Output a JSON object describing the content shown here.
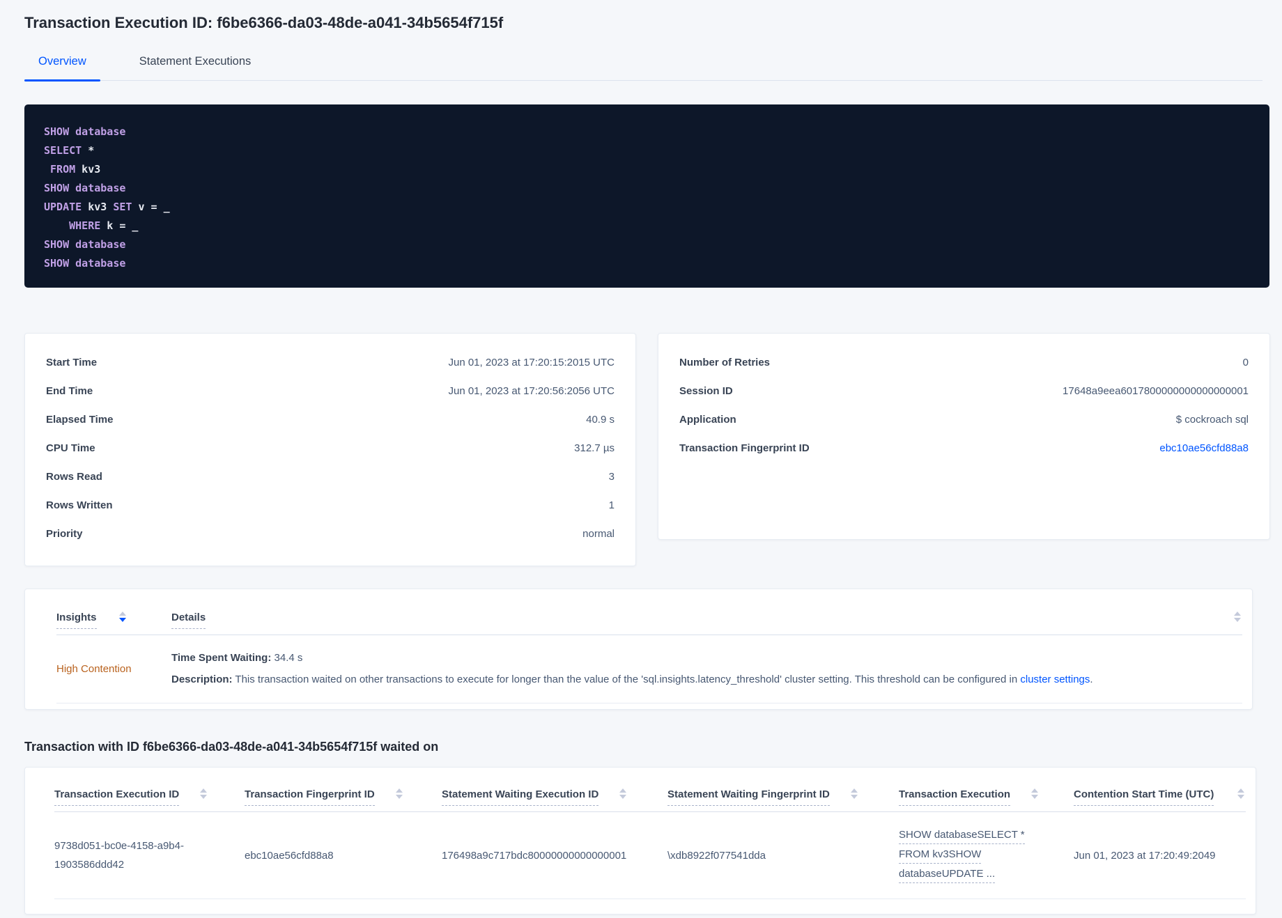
{
  "colors": {
    "accent_blue": "#0055ff",
    "warning_orange": "#b9621e",
    "code_background": "#0d1729",
    "code_keyword": "#c0a0e6",
    "code_plain": "#e7eaf1"
  },
  "page": {
    "title": "Transaction Execution ID: f6be6366-da03-48de-a041-34b5654f715f"
  },
  "tabs": {
    "overview": "Overview",
    "statement_executions": "Statement Executions"
  },
  "sql_box": {
    "lines": [
      [
        [
          "SHOW",
          1
        ],
        [
          " ",
          0
        ],
        [
          "database",
          1
        ]
      ],
      [
        [
          "SELECT",
          1
        ],
        [
          " *",
          0
        ]
      ],
      [
        [
          " ",
          0
        ],
        [
          "FROM",
          1
        ],
        [
          " kv3",
          0
        ]
      ],
      [
        [
          "SHOW",
          1
        ],
        [
          " ",
          0
        ],
        [
          "database",
          1
        ]
      ],
      [
        [
          "UPDATE",
          1
        ],
        [
          " kv3 ",
          0
        ],
        [
          "SET",
          1
        ],
        [
          " v = _",
          0
        ]
      ],
      [
        [
          "    ",
          0
        ],
        [
          "WHERE",
          1
        ],
        [
          " k = _",
          0
        ]
      ],
      [
        [
          "SHOW",
          1
        ],
        [
          " ",
          0
        ],
        [
          "database",
          1
        ]
      ],
      [
        [
          "SHOW",
          1
        ],
        [
          " ",
          0
        ],
        [
          "database",
          1
        ]
      ]
    ]
  },
  "details_left": {
    "rows": [
      {
        "label": "Start Time",
        "value": "Jun 01, 2023 at 17:20:15:2015 UTC"
      },
      {
        "label": "End Time",
        "value": "Jun 01, 2023 at 17:20:56:2056 UTC"
      },
      {
        "label": "Elapsed Time",
        "value": "40.9 s"
      },
      {
        "label": "CPU Time",
        "value": "312.7 µs"
      },
      {
        "label": "Rows Read",
        "value": "3"
      },
      {
        "label": "Rows Written",
        "value": "1"
      },
      {
        "label": "Priority",
        "value": "normal"
      }
    ]
  },
  "details_right": {
    "rows": [
      {
        "label": "Number of Retries",
        "value": "0"
      },
      {
        "label": "Session ID",
        "value": "17648a9eea6017800000000000000001"
      },
      {
        "label": "Application",
        "value": "$ cockroach sql"
      },
      {
        "label": "Transaction Fingerprint ID",
        "value": "ebc10ae56cfd88a8"
      }
    ]
  },
  "insights_table": {
    "col_insights": "Insights",
    "col_details": "Details",
    "row": {
      "insight": "High Contention",
      "waiting_label": "Time Spent Waiting:",
      "waiting_value": " 34.4 s",
      "desc_label": "Description:",
      "desc_text": " This transaction waited on other transactions to execute for longer than the value of the 'sql.insights.latency_threshold' cluster setting. This threshold can be configured in ",
      "desc_link": "cluster settings",
      "desc_after": "."
    }
  },
  "waited_on": {
    "heading": "Transaction with ID f6be6366-da03-48de-a041-34b5654f715f waited on",
    "columns": [
      "Transaction Execution ID",
      "Transaction Fingerprint ID",
      "Statement Waiting Execution ID",
      "Statement Waiting Fingerprint ID",
      "Transaction Execution",
      "Contention Start Time (UTC)"
    ],
    "row": {
      "txn_execution_id": "9738d051-bc0e-4158-a9b4-1903586ddd42",
      "txn_fingerprint_id": "ebc10ae56cfd88a8",
      "stmt_waiting_execution_id": "176498a9c717bdc80000000000000001",
      "stmt_waiting_fingerprint_id": "\\xdb8922f077541dda",
      "txn_execution_lines": [
        "SHOW databaseSELECT *",
        "FROM kv3SHOW",
        "databaseUPDATE ..."
      ],
      "contention_start": "Jun 01, 2023 at 17:20:49:2049"
    }
  }
}
